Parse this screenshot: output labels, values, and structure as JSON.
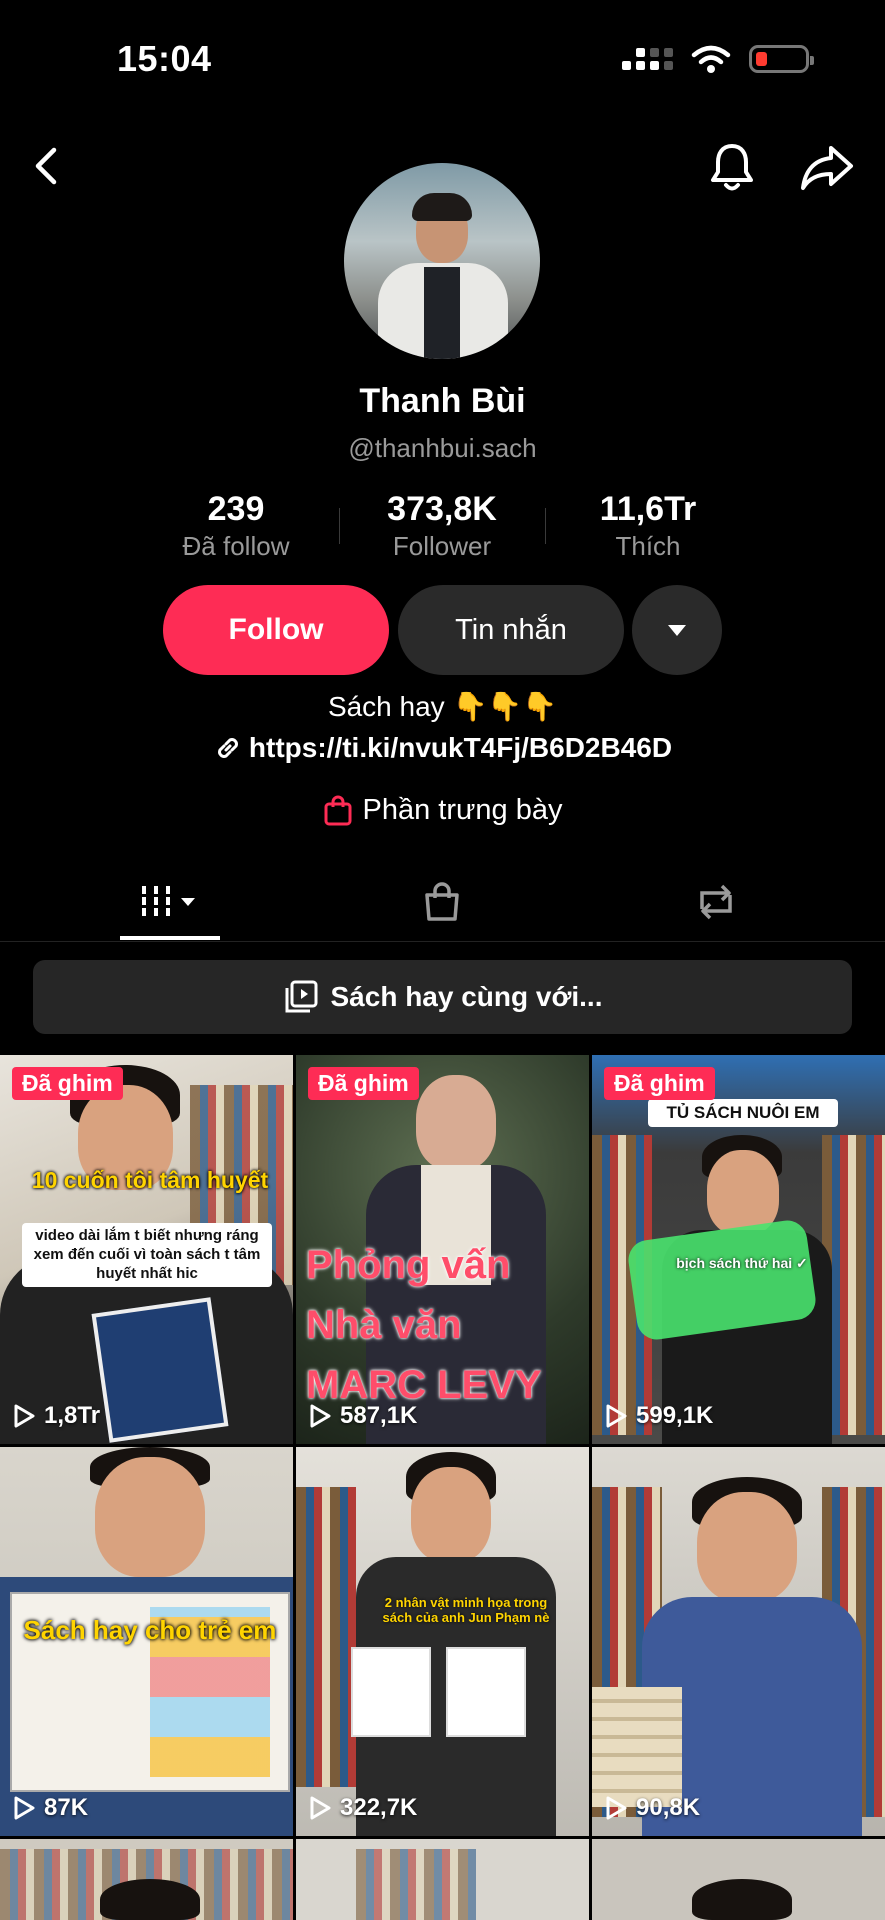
{
  "status_bar": {
    "time": "15:04"
  },
  "nav": {
    "back_icon": "chevron-left-icon",
    "bell_icon": "bell-icon",
    "share_icon": "share-arrow-icon"
  },
  "profile": {
    "name": "Thanh Bùi",
    "handle": "@thanhbui.sach",
    "stats": [
      {
        "value": "239",
        "label": "Đã follow"
      },
      {
        "value": "373,8K",
        "label": "Follower"
      },
      {
        "value": "11,6Tr",
        "label": "Thích"
      }
    ],
    "follow_label": "Follow",
    "message_label": "Tin nhắn",
    "bio": "Sách hay 👇👇👇",
    "link": "https://ti.ki/nvukT4Fj/B6D2B46D",
    "showcase_label": "Phần trưng bày"
  },
  "tabs": [
    {
      "icon": "videos-grid-icon"
    },
    {
      "icon": "shopping-bag-icon"
    },
    {
      "icon": "repost-icon"
    }
  ],
  "playlist": {
    "label": "Sách hay cùng với..."
  },
  "videos": [
    {
      "badge": "Đã ghim",
      "views": "1,8Tr",
      "overlay": "10 cuốn tôi tâm huyết",
      "caption": "video dài lắm t biết nhưng ráng xem đến cuối vì toàn sách t tâm huyết nhất hic"
    },
    {
      "badge": "Đã ghim",
      "views": "587,1K",
      "overlay": "Phỏng vấn Nhà văn MARC LEVY"
    },
    {
      "badge": "Đã ghim",
      "views": "599,1K",
      "overlay": "TỦ SÁCH NUÔI EM",
      "caption": "bịch sách thứ hai ✓"
    },
    {
      "views": "87K",
      "overlay": "Sách hay cho trẻ em"
    },
    {
      "views": "322,7K",
      "overlay": "2 nhân vật minh họa trong sách của anh Jun Phạm nè"
    },
    {
      "views": "90,8K"
    }
  ],
  "colors": {
    "accent": "#fe2c55",
    "secondary_button": "#2a2a2a",
    "muted_text": "#9a9a9a"
  }
}
